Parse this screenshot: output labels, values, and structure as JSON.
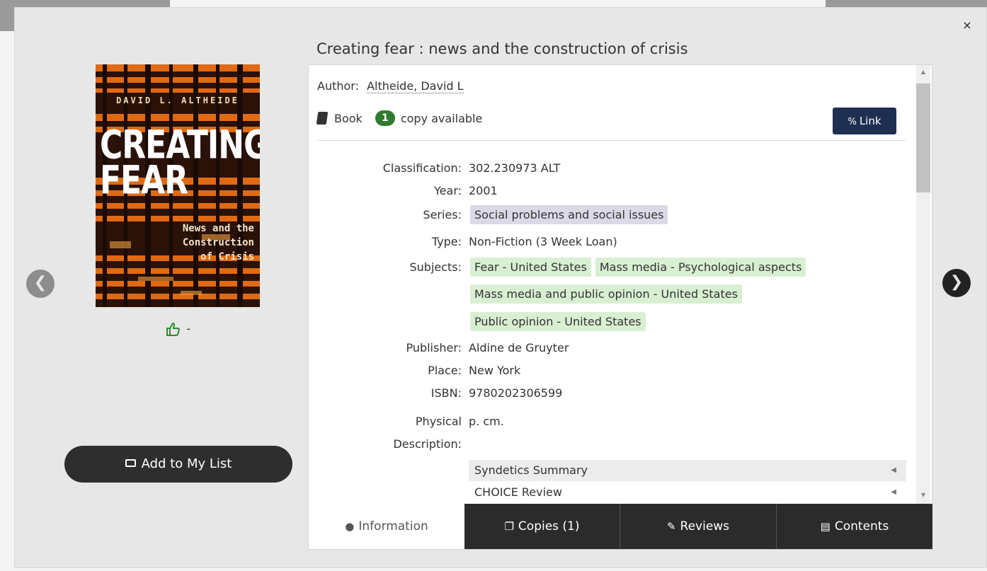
{
  "modal": {
    "close_label": "×",
    "title": "Creating fear : news and the construction of crisis",
    "prev_icon": "chevron-left-icon",
    "next_icon": "chevron-right-icon",
    "prev_label": "❮",
    "next_label": "❯"
  },
  "cover": {
    "author": "DAVID L. ALTHEIDE",
    "title_line1": "CREATING",
    "title_line2": "FEAR",
    "subtitle_line1": "News and the",
    "subtitle_line2": "Construction",
    "subtitle_line3": "of Crisis"
  },
  "rating": {
    "icon": "thumbs-up-icon",
    "value": "-"
  },
  "add_list": {
    "label": "Add to My List",
    "icon": "list-icon"
  },
  "record": {
    "author_label": "Author:",
    "author_value": "Altheide, David L",
    "format": "Book",
    "format_icon": "book-icon",
    "copies_count": "1",
    "copies_text": "copy available",
    "link_label": "Link",
    "link_icon": "link-icon",
    "fields": {
      "classification_label": "Classification:",
      "classification_value": "302.230973 ALT",
      "year_label": "Year:",
      "year_value": "2001",
      "series_label": "Series:",
      "series_value": "Social problems and social issues",
      "type_label": "Type:",
      "type_value": "Non-Fiction (3 Week Loan)",
      "subjects_label": "Subjects:",
      "subjects": [
        "Fear - United States",
        "Mass media - Psychological aspects",
        "Mass media and public opinion - United States",
        "Public opinion - United States"
      ],
      "publisher_label": "Publisher:",
      "publisher_value": "Aldine de Gruyter",
      "place_label": "Place:",
      "place_value": "New York",
      "isbn_label": "ISBN:",
      "isbn_value": "9780202306599",
      "physical_label_1": "Physical",
      "physical_label_2": "Description:",
      "physical_value": "p. cm."
    },
    "accordions": [
      "Syndetics Summary",
      "CHOICE Review"
    ]
  },
  "tabs": [
    {
      "label": "Information",
      "icon": "info-icon",
      "active": true
    },
    {
      "label": "Copies (1)",
      "icon": "copies-icon",
      "active": false
    },
    {
      "label": "Reviews",
      "icon": "edit-icon",
      "active": false
    },
    {
      "label": "Contents",
      "icon": "document-icon",
      "active": false
    }
  ],
  "colors": {
    "link_button": "#1e2f52",
    "badge_green": "#2f7a2f",
    "series_tag": "#dcd9e7",
    "subject_tag": "#d9efd2",
    "tab_dark": "#2b2b2b"
  }
}
